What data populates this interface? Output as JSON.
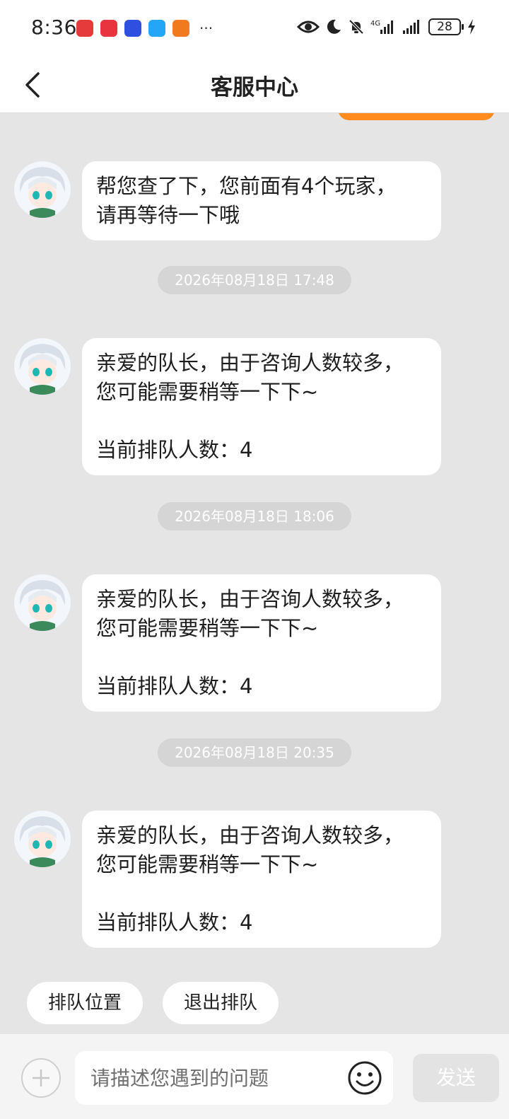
{
  "status_bar": {
    "time": "8:36",
    "battery": "28",
    "network": "4G",
    "app_icons": [
      {
        "name": "news-app-icon",
        "color": "#e63b3b"
      },
      {
        "name": "huawei-app-icon",
        "color": "#e8343f"
      },
      {
        "name": "blue-app-icon",
        "color": "#2f4fe0"
      },
      {
        "name": "message-app-icon",
        "color": "#22a6f5"
      },
      {
        "name": "orange-app-icon",
        "color": "#f07a1d"
      }
    ],
    "more": "···"
  },
  "header": {
    "title": "客服中心"
  },
  "messages": [
    {
      "lines": [
        "帮您查了下，您前面有4个玩家，",
        "请再等待一下哦"
      ]
    },
    {
      "lines": [
        "亲爱的队长，由于咨询人数较多，",
        "您可能需要稍等一下下~",
        "",
        "当前排队人数：4"
      ]
    },
    {
      "lines": [
        "亲爱的队长，由于咨询人数较多，",
        "您可能需要稍等一下下~",
        "",
        "当前排队人数：4"
      ]
    },
    {
      "lines": [
        "亲爱的队长，由于咨询人数较多，",
        "您可能需要稍等一下下~",
        "",
        "当前排队人数：4"
      ]
    }
  ],
  "timestamps": [
    "2026年08月18日 17:48",
    "2026年08月18日 18:06",
    "2026年08月18日 20:35"
  ],
  "quick_replies": [
    "排队位置",
    "退出排队"
  ],
  "input": {
    "placeholder": "请描述您遇到的问题",
    "value": ""
  },
  "send_label": "发送",
  "colors": {
    "accent": "#ff8a1e",
    "chat_bg": "#e5e5e5",
    "bubble_bg": "#ffffff",
    "timestamp_bg": "#d5d5d5",
    "send_disabled_bg": "#e3e3e3"
  }
}
